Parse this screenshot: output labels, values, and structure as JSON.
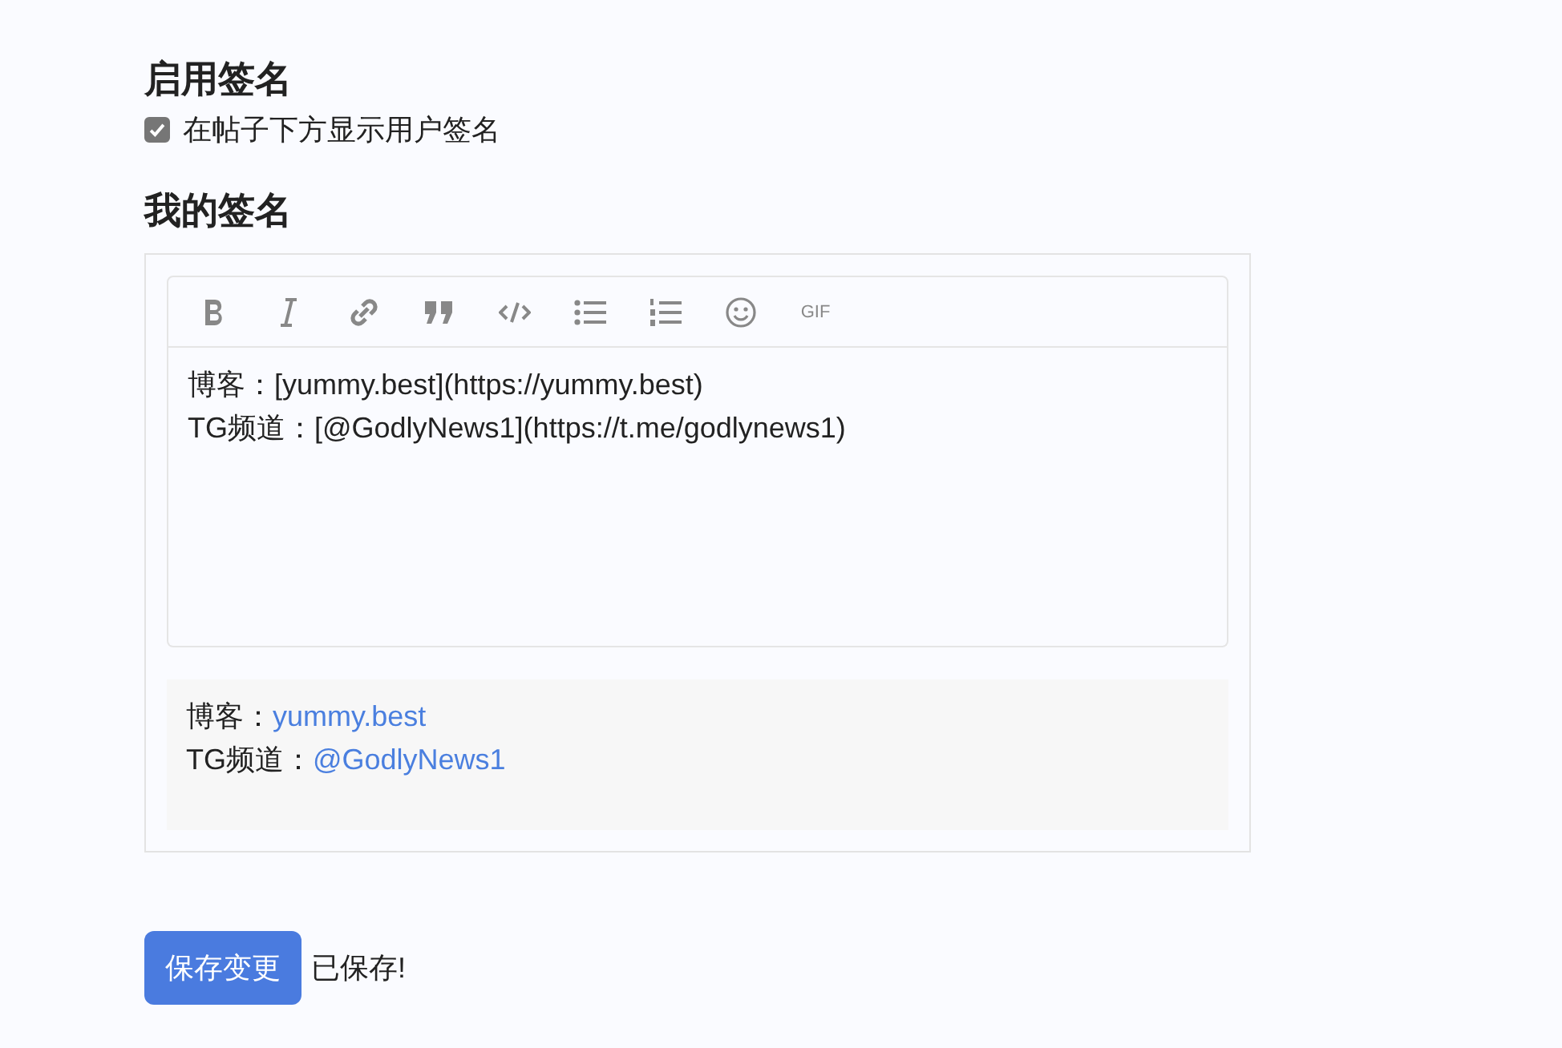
{
  "enable_section": {
    "heading": "启用签名",
    "checkbox": {
      "label": "在帖子下方显示用户签名",
      "checked": true
    }
  },
  "signature_section": {
    "heading": "我的签名",
    "toolbar": [
      {
        "kind": "bold"
      },
      {
        "kind": "italic"
      },
      {
        "kind": "link"
      },
      {
        "kind": "quote"
      },
      {
        "kind": "code"
      },
      {
        "kind": "bullet-list"
      },
      {
        "kind": "numbered-list"
      },
      {
        "kind": "emoji"
      },
      {
        "kind": "gif",
        "label": "GIF"
      }
    ],
    "editor": {
      "value": [
        "博客：[yummy.best](https://yummy.best)",
        "TG频道：[@GodlyNews1](https://t.me/godlynews1)"
      ]
    },
    "preview": [
      {
        "prefix": "博客：",
        "link": "yummy.best"
      },
      {
        "prefix": "TG频道：",
        "link": "@GodlyNews1"
      }
    ]
  },
  "save_button": "保存变更",
  "status": "已保存!"
}
